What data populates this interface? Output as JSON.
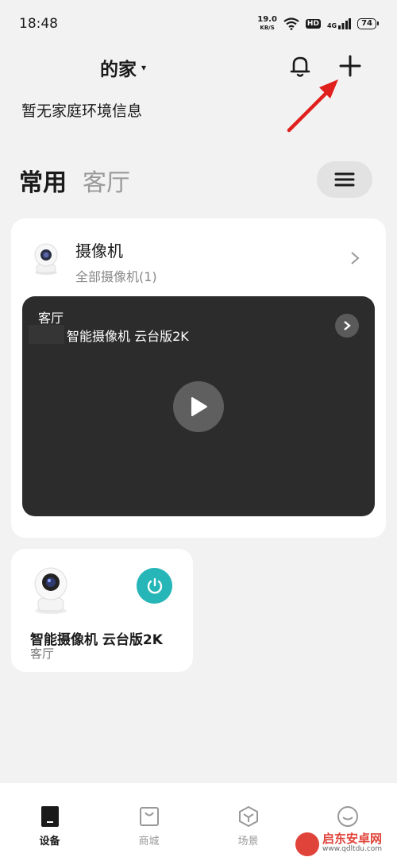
{
  "status_bar": {
    "time": "18:48",
    "net_speed_value": "19.0",
    "net_speed_unit": "KB/S",
    "hd": "HD",
    "signal": "4G",
    "battery": "74"
  },
  "header": {
    "home_title": "的家",
    "caret": "▾"
  },
  "env_info": "暂无家庭环境信息",
  "tabs": [
    {
      "label": "常用",
      "active": true
    },
    {
      "label": "客厅",
      "active": false
    }
  ],
  "camera_group": {
    "title": "摄像机",
    "subtitle": "全部摄像机(1)",
    "preview": {
      "room": "客厅",
      "device_name": "智能摄像机 云台版2K"
    }
  },
  "device_card": {
    "name": "智能摄像机 云台版2K",
    "room": "客厅",
    "power_color": "#27b6b8"
  },
  "bottom_nav": [
    {
      "label": "设备",
      "icon": "device-icon",
      "active": true
    },
    {
      "label": "商城",
      "icon": "shop-bag-icon",
      "active": false
    },
    {
      "label": "场景",
      "icon": "scene-cube-icon",
      "active": false
    },
    {
      "label": "",
      "icon": "profile-icon",
      "active": false
    }
  ],
  "watermark": {
    "title": "启东安卓网",
    "url": "www.qdltdu.com"
  },
  "colors": {
    "accent": "#27b6b8",
    "annotation_arrow": "#e0201c"
  }
}
